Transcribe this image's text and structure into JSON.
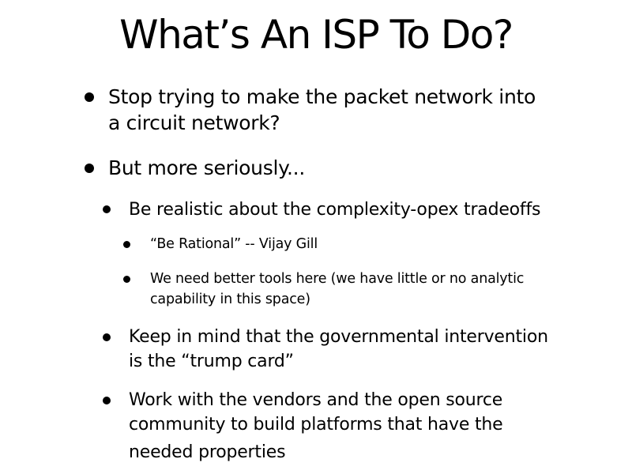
{
  "slide": {
    "title": "What’s An ISP To Do?",
    "bullets": [
      {
        "level": 1,
        "lines": [
          "Stop trying to make the packet network into",
          "a circuit network?"
        ]
      },
      {
        "level": 1,
        "lines": [
          "But more seriously..."
        ]
      },
      {
        "level": 2,
        "lines": [
          "Be realistic about the complexity-opex tradeoffs"
        ]
      },
      {
        "level": 3,
        "lines": [
          "“Be Rational” -- Vijay Gill"
        ]
      },
      {
        "level": 3,
        "lines": [
          "We need better tools here (we have little or no analytic",
          "capability in this space)"
        ]
      },
      {
        "level": 2,
        "lines": [
          "Keep in mind that the governmental intervention",
          "is the “trump card”"
        ]
      },
      {
        "level": 2,
        "lines": [
          "Work with the vendors and the open source",
          "community to build platforms that have the",
          "needed properties"
        ]
      }
    ]
  }
}
